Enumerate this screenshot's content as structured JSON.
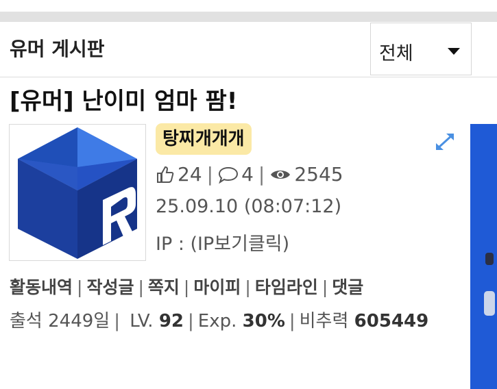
{
  "board": {
    "title": "유머 게시판",
    "filter_value": "전체"
  },
  "post": {
    "title": "[유머] 난이미 엄마 팜!",
    "author": "탕찌개개개",
    "likes": "24",
    "comments": "4",
    "views": "2545",
    "date": "25.09.10 (08:07:12)",
    "ip": "IP : (IP보기클릭)"
  },
  "profile_links": [
    "활동내역",
    "작성글",
    "쪽지",
    "마이피",
    "타임라인",
    "댓글"
  ],
  "profile_info": {
    "attendance": "출석 2449일",
    "level_label": "LV.",
    "level_value": "92",
    "exp_label": "Exp.",
    "exp_value": "30%",
    "power_label": "비추력",
    "power_value": "605449"
  },
  "icons": {
    "like": "thumbs-up-icon",
    "comment": "comment-icon",
    "views": "eye-icon",
    "expand": "expand-icon",
    "filter": "caret-down-icon"
  },
  "colors": {
    "nick_badge": "#fbe9a6",
    "expand_icon": "#4a90e2",
    "side_banner": "#1f5ad6"
  }
}
